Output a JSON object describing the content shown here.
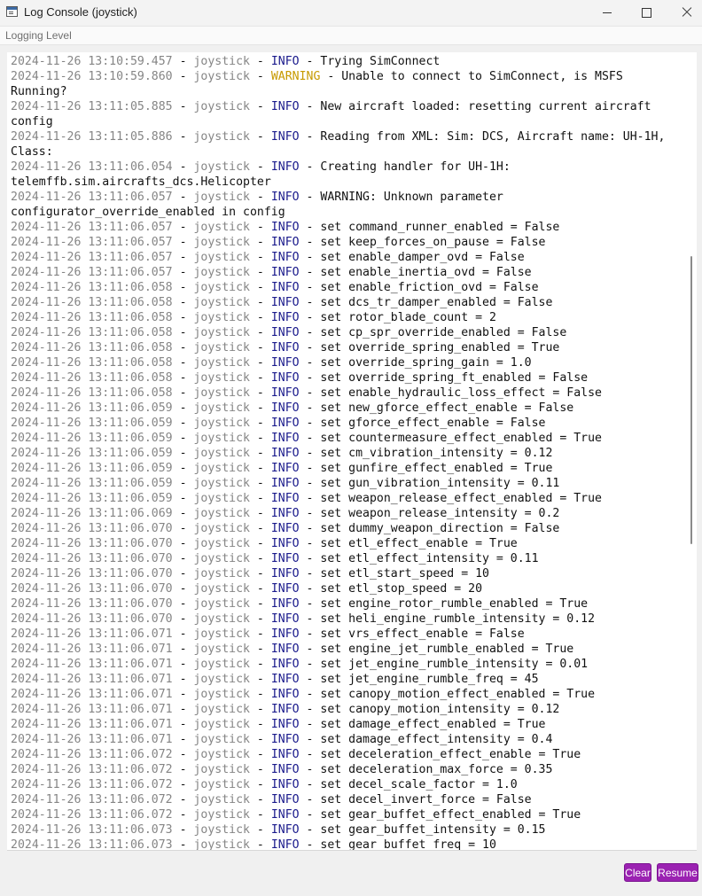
{
  "window": {
    "title": "Log Console (joystick)",
    "controls": {
      "minimize": "minimize",
      "maximize": "maximize",
      "close": "close"
    }
  },
  "menubar": {
    "items": [
      "Logging Level"
    ]
  },
  "colors": {
    "info": "#1a1a8c",
    "warning": "#c79a00",
    "timestamp": "#858585",
    "button": "#9b22b2"
  },
  "log": {
    "lines": [
      [
        "2024-11-26 13:10:59.457",
        " - ",
        "joystick",
        " - ",
        "INFO",
        " - Trying SimConnect",
        "info"
      ],
      [
        "2024-11-26 13:10:59.860",
        " - ",
        "joystick",
        " - ",
        "WARNING",
        " - Unable to connect to SimConnect, is MSFS",
        "warning"
      ],
      [
        "",
        "",
        "",
        "",
        "",
        "Running?",
        "cont"
      ],
      [
        "2024-11-26 13:11:05.885",
        " - ",
        "joystick",
        " - ",
        "INFO",
        " - New aircraft loaded: resetting current aircraft",
        "info"
      ],
      [
        "",
        "",
        "",
        "",
        "",
        "config",
        "cont"
      ],
      [
        "2024-11-26 13:11:05.886",
        " - ",
        "joystick",
        " - ",
        "INFO",
        " - Reading from XML:  Sim: DCS, Aircraft name: UH-1H,",
        "info"
      ],
      [
        "",
        "",
        "",
        "",
        "",
        "Class:",
        "cont"
      ],
      [
        "2024-11-26 13:11:06.054",
        " - ",
        "joystick",
        " - ",
        "INFO",
        " - Creating handler for UH-1H:",
        "info"
      ],
      [
        "",
        "",
        "",
        "",
        "",
        "telemffb.sim.aircrafts_dcs.Helicopter",
        "cont"
      ],
      [
        "2024-11-26 13:11:06.057",
        " - ",
        "joystick",
        " - ",
        "INFO",
        " - WARNING: Unknown parameter",
        "info"
      ],
      [
        "",
        "",
        "",
        "",
        "",
        "configurator_override_enabled in config",
        "cont"
      ],
      [
        "2024-11-26 13:11:06.057",
        " - ",
        "joystick",
        " - ",
        "INFO",
        " - set command_runner_enabled = False",
        "info"
      ],
      [
        "2024-11-26 13:11:06.057",
        " - ",
        "joystick",
        " - ",
        "INFO",
        " - set keep_forces_on_pause = False",
        "info"
      ],
      [
        "2024-11-26 13:11:06.057",
        " - ",
        "joystick",
        " - ",
        "INFO",
        " - set enable_damper_ovd = False",
        "info"
      ],
      [
        "2024-11-26 13:11:06.057",
        " - ",
        "joystick",
        " - ",
        "INFO",
        " - set enable_inertia_ovd = False",
        "info"
      ],
      [
        "2024-11-26 13:11:06.058",
        " - ",
        "joystick",
        " - ",
        "INFO",
        " - set enable_friction_ovd = False",
        "info"
      ],
      [
        "2024-11-26 13:11:06.058",
        " - ",
        "joystick",
        " - ",
        "INFO",
        " - set dcs_tr_damper_enabled = False",
        "info"
      ],
      [
        "2024-11-26 13:11:06.058",
        " - ",
        "joystick",
        " - ",
        "INFO",
        " - set rotor_blade_count = 2",
        "info"
      ],
      [
        "2024-11-26 13:11:06.058",
        " - ",
        "joystick",
        " - ",
        "INFO",
        " - set cp_spr_override_enabled = False",
        "info"
      ],
      [
        "2024-11-26 13:11:06.058",
        " - ",
        "joystick",
        " - ",
        "INFO",
        " - set override_spring_enabled = True",
        "info"
      ],
      [
        "2024-11-26 13:11:06.058",
        " - ",
        "joystick",
        " - ",
        "INFO",
        " - set override_spring_gain = 1.0",
        "info"
      ],
      [
        "2024-11-26 13:11:06.058",
        " - ",
        "joystick",
        " - ",
        "INFO",
        " - set override_spring_ft_enabled = False",
        "info"
      ],
      [
        "2024-11-26 13:11:06.058",
        " - ",
        "joystick",
        " - ",
        "INFO",
        " - set enable_hydraulic_loss_effect = False",
        "info"
      ],
      [
        "2024-11-26 13:11:06.059",
        " - ",
        "joystick",
        " - ",
        "INFO",
        " - set new_gforce_effect_enable = False",
        "info"
      ],
      [
        "2024-11-26 13:11:06.059",
        " - ",
        "joystick",
        " - ",
        "INFO",
        " - set gforce_effect_enable = False",
        "info"
      ],
      [
        "2024-11-26 13:11:06.059",
        " - ",
        "joystick",
        " - ",
        "INFO",
        " - set countermeasure_effect_enabled = True",
        "info"
      ],
      [
        "2024-11-26 13:11:06.059",
        " - ",
        "joystick",
        " - ",
        "INFO",
        " - set cm_vibration_intensity = 0.12",
        "info"
      ],
      [
        "2024-11-26 13:11:06.059",
        " - ",
        "joystick",
        " - ",
        "INFO",
        " - set gunfire_effect_enabled = True",
        "info"
      ],
      [
        "2024-11-26 13:11:06.059",
        " - ",
        "joystick",
        " - ",
        "INFO",
        " - set gun_vibration_intensity = 0.11",
        "info"
      ],
      [
        "2024-11-26 13:11:06.059",
        " - ",
        "joystick",
        " - ",
        "INFO",
        " - set weapon_release_effect_enabled = True",
        "info"
      ],
      [
        "2024-11-26 13:11:06.069",
        " - ",
        "joystick",
        " - ",
        "INFO",
        " - set weapon_release_intensity = 0.2",
        "info"
      ],
      [
        "2024-11-26 13:11:06.070",
        " - ",
        "joystick",
        " - ",
        "INFO",
        " - set dummy_weapon_direction = False",
        "info"
      ],
      [
        "2024-11-26 13:11:06.070",
        " - ",
        "joystick",
        " - ",
        "INFO",
        " - set etl_effect_enable = True",
        "info"
      ],
      [
        "2024-11-26 13:11:06.070",
        " - ",
        "joystick",
        " - ",
        "INFO",
        " - set etl_effect_intensity = 0.11",
        "info"
      ],
      [
        "2024-11-26 13:11:06.070",
        " - ",
        "joystick",
        " - ",
        "INFO",
        " - set etl_start_speed = 10",
        "info"
      ],
      [
        "2024-11-26 13:11:06.070",
        " - ",
        "joystick",
        " - ",
        "INFO",
        " - set etl_stop_speed = 20",
        "info"
      ],
      [
        "2024-11-26 13:11:06.070",
        " - ",
        "joystick",
        " - ",
        "INFO",
        " - set engine_rotor_rumble_enabled = True",
        "info"
      ],
      [
        "2024-11-26 13:11:06.070",
        " - ",
        "joystick",
        " - ",
        "INFO",
        " - set heli_engine_rumble_intensity = 0.12",
        "info"
      ],
      [
        "2024-11-26 13:11:06.071",
        " - ",
        "joystick",
        " - ",
        "INFO",
        " - set vrs_effect_enable = False",
        "info"
      ],
      [
        "2024-11-26 13:11:06.071",
        " - ",
        "joystick",
        " - ",
        "INFO",
        " - set engine_jet_rumble_enabled = True",
        "info"
      ],
      [
        "2024-11-26 13:11:06.071",
        " - ",
        "joystick",
        " - ",
        "INFO",
        " - set jet_engine_rumble_intensity = 0.01",
        "info"
      ],
      [
        "2024-11-26 13:11:06.071",
        " - ",
        "joystick",
        " - ",
        "INFO",
        " - set jet_engine_rumble_freq = 45",
        "info"
      ],
      [
        "2024-11-26 13:11:06.071",
        " - ",
        "joystick",
        " - ",
        "INFO",
        " - set canopy_motion_effect_enabled = True",
        "info"
      ],
      [
        "2024-11-26 13:11:06.071",
        " - ",
        "joystick",
        " - ",
        "INFO",
        " - set canopy_motion_intensity = 0.12",
        "info"
      ],
      [
        "2024-11-26 13:11:06.071",
        " - ",
        "joystick",
        " - ",
        "INFO",
        " - set damage_effect_enabled = True",
        "info"
      ],
      [
        "2024-11-26 13:11:06.071",
        " - ",
        "joystick",
        " - ",
        "INFO",
        " - set damage_effect_intensity = 0.4",
        "info"
      ],
      [
        "2024-11-26 13:11:06.072",
        " - ",
        "joystick",
        " - ",
        "INFO",
        " - set deceleration_effect_enable = True",
        "info"
      ],
      [
        "2024-11-26 13:11:06.072",
        " - ",
        "joystick",
        " - ",
        "INFO",
        " - set deceleration_max_force = 0.35",
        "info"
      ],
      [
        "2024-11-26 13:11:06.072",
        " - ",
        "joystick",
        " - ",
        "INFO",
        " - set decel_scale_factor = 1.0",
        "info"
      ],
      [
        "2024-11-26 13:11:06.072",
        " - ",
        "joystick",
        " - ",
        "INFO",
        " - set decel_invert_force = False",
        "info"
      ],
      [
        "2024-11-26 13:11:06.072",
        " - ",
        "joystick",
        " - ",
        "INFO",
        " - set gear_buffet_effect_enabled = True",
        "info"
      ],
      [
        "2024-11-26 13:11:06.073",
        " - ",
        "joystick",
        " - ",
        "INFO",
        " - set gear_buffet_intensity = 0.15",
        "info"
      ],
      [
        "2024-11-26 13:11:06.073",
        " - ",
        "joystick",
        " - ",
        "INFO",
        " - set gear_buffet_freq = 10",
        "info"
      ]
    ]
  },
  "scrollbar": {
    "position": 0.4
  },
  "buttons": {
    "clear": "Clear",
    "resume": "Resume"
  }
}
